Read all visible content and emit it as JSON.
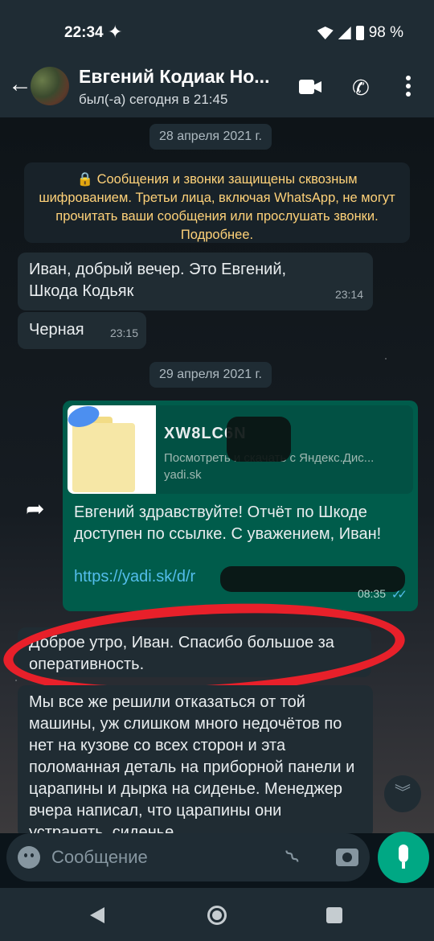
{
  "status_bar": {
    "time": "22:34",
    "battery": "98 %"
  },
  "header": {
    "contact_name": "Евгений Кодиак Но...",
    "last_seen": "был(-а) сегодня в 21:45"
  },
  "chat": {
    "date_1": "28 апреля 2021 г.",
    "encryption_notice": "🔒 Сообщения и звонки защищены сквозным шифрованием. Третьи лица, включая WhatsApp, не могут прочитать ваши сообщения или прослушать звонки. Подробнее.",
    "msg_1": {
      "text": "Иван,  добрый вечер. Это Евгений, Шкода Кодьяк",
      "time": "23:14"
    },
    "msg_2": {
      "text": "Черная",
      "time": "23:15"
    },
    "date_2": "29 апреля 2021 г.",
    "msg_3": {
      "preview_title": "XW8LC6N",
      "preview_desc": "Посмотреть и скачать с Яндекс.Дис...",
      "preview_domain": "yadi.sk",
      "text": "Евгений здравствуйте! Отчёт по Шкоде доступен по ссылке. С уважением, Иван!",
      "link": "https://yadi.sk/d/r",
      "time": "08:35",
      "ticks": "✓✓"
    },
    "msg_4": {
      "text": "Доброе утро, Иван. Спасибо большое за оперативность."
    },
    "msg_5": {
      "text": "Мы все же решили отказаться от той машины, уж слишком много недочётов по нет на кузове со всех сторон и эта поломанная деталь на приборной панели и царапины и дырка на сиденье. Менеджер вчера написал, что царапины они устранять, сиденье"
    }
  },
  "composer": {
    "placeholder": "Сообщение"
  },
  "icons": {
    "back": "arrow-back-icon",
    "video": "video-call-icon",
    "call": "phone-icon",
    "menu": "more-vert-icon",
    "forward": "forward-icon",
    "emoji": "emoji-icon",
    "attach": "paperclip-icon",
    "camera": "camera-icon",
    "mic": "mic-icon",
    "scroll_down": "chevron-double-down-icon"
  },
  "colors": {
    "outgoing_bubble": "#005c4b",
    "incoming_bubble": "#202c33",
    "accent": "#00a884",
    "notice_text": "#ffd279",
    "highlight": "#e8202a"
  }
}
